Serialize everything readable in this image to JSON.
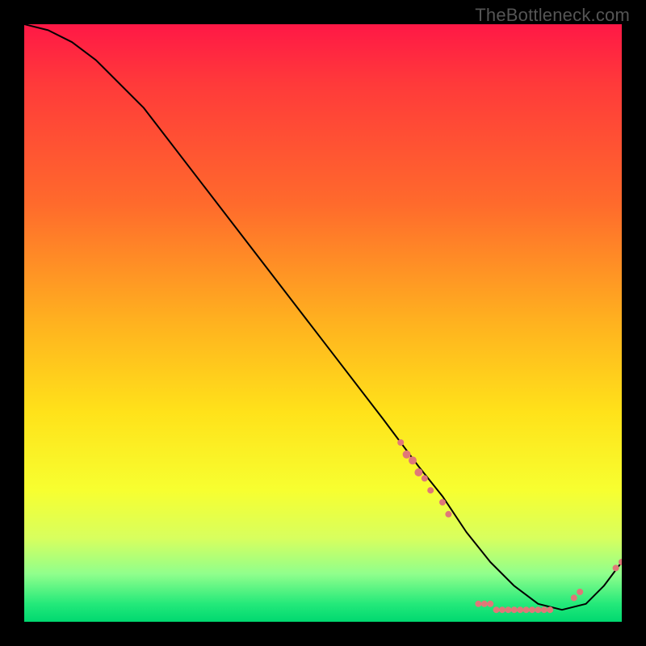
{
  "watermark": "TheBottleneck.com",
  "colors": {
    "marker": "#e07878",
    "curve": "#000000",
    "background_top": "#ff1846",
    "background_bottom": "#00d870"
  },
  "chart_data": {
    "type": "line",
    "title": "",
    "xlabel": "",
    "ylabel": "",
    "xlim": [
      0,
      100
    ],
    "ylim": [
      0,
      100
    ],
    "grid": false,
    "legend": false,
    "series": [
      {
        "name": "curve",
        "x": [
          0,
          4,
          8,
          12,
          20,
          30,
          40,
          50,
          60,
          66,
          70,
          74,
          78,
          82,
          86,
          90,
          94,
          97,
          100
        ],
        "y": [
          100,
          99,
          97,
          94,
          86,
          73,
          60,
          47,
          34,
          26,
          21,
          15,
          10,
          6,
          3,
          2,
          3,
          6,
          10
        ]
      }
    ],
    "markers": [
      {
        "x": 63,
        "y": 30,
        "r": 4
      },
      {
        "x": 64,
        "y": 28,
        "r": 5
      },
      {
        "x": 65,
        "y": 27,
        "r": 5
      },
      {
        "x": 66,
        "y": 25,
        "r": 5
      },
      {
        "x": 67,
        "y": 24,
        "r": 4
      },
      {
        "x": 68,
        "y": 22,
        "r": 4
      },
      {
        "x": 70,
        "y": 20,
        "r": 4
      },
      {
        "x": 71,
        "y": 18,
        "r": 4
      },
      {
        "x": 76,
        "y": 3,
        "r": 4
      },
      {
        "x": 77,
        "y": 3,
        "r": 4
      },
      {
        "x": 78,
        "y": 3,
        "r": 4
      },
      {
        "x": 79,
        "y": 2,
        "r": 4
      },
      {
        "x": 80,
        "y": 2,
        "r": 4
      },
      {
        "x": 81,
        "y": 2,
        "r": 4
      },
      {
        "x": 82,
        "y": 2,
        "r": 4
      },
      {
        "x": 83,
        "y": 2,
        "r": 4
      },
      {
        "x": 84,
        "y": 2,
        "r": 4
      },
      {
        "x": 85,
        "y": 2,
        "r": 4
      },
      {
        "x": 86,
        "y": 2,
        "r": 4
      },
      {
        "x": 87,
        "y": 2,
        "r": 4
      },
      {
        "x": 88,
        "y": 2,
        "r": 4
      },
      {
        "x": 92,
        "y": 4,
        "r": 4
      },
      {
        "x": 93,
        "y": 5,
        "r": 4
      },
      {
        "x": 99,
        "y": 9,
        "r": 4
      },
      {
        "x": 100,
        "y": 10,
        "r": 4
      }
    ]
  }
}
